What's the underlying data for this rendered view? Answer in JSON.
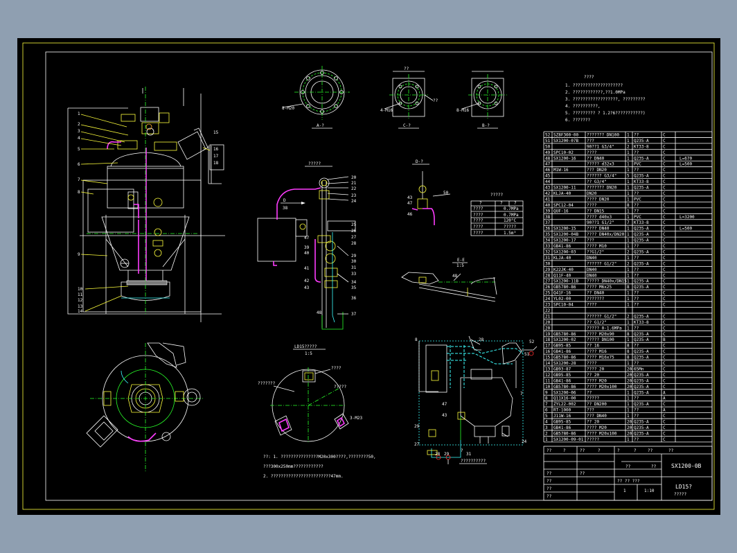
{
  "notes": {
    "title": "????",
    "items": [
      "1. ????????????????????",
      "2. ????????????,??1.0MPa",
      "3. ??????????????????,  ?????????",
      "4. ??????????,",
      "5. ?????????  ?  1.2?6???????????)",
      "6. ???????"
    ]
  },
  "pressure_table": {
    "title": "?????",
    "header": [
      "?",
      "?",
      "?"
    ],
    "rows": [
      [
        "????",
        "0.7MPa"
      ],
      [
        "????",
        "0.7MPa"
      ],
      [
        "????",
        "120°C"
      ],
      [
        "????",
        "?????"
      ],
      [
        "????",
        "1.5m³"
      ]
    ]
  },
  "section_labels": {
    "a": "A-?",
    "c": "C-?",
    "b": "B-?",
    "d": "D-?",
    "e": "E-E",
    "e_scale": "1:5",
    "ld": "LD15?????",
    "ld_scale": "1:5",
    "pipe_top": "?????",
    "bolts1": "8-M20",
    "bolts2": "4-M16",
    "bolts3": "8-M16",
    "bolts4": "3-M23",
    "system": "??????????",
    "ld_label1": "????",
    "ld_label2": "???????",
    "ld_label3": "?????"
  },
  "bottom_notes": [
    "??:  1. ???????????????M20x300????,????????50,",
    "       ???300x250mm????????????",
    "       2. ????????????????????????47mm."
  ],
  "parts": [
    [
      "52",
      "SZ8F300-00",
      "??????? DN100",
      "1",
      "??",
      "C"
    ],
    [
      "51",
      "SX1200-07B",
      "???",
      "1",
      "Q235-A",
      "C"
    ],
    [
      "50",
      "",
      "90??1  G3/4\"",
      "2",
      "KT33-8",
      "C"
    ],
    [
      "49",
      "SPC10-02",
      "????",
      "1",
      "??",
      "C"
    ],
    [
      "48",
      "SX1200-16",
      "??  DN40",
      "1",
      "Q235-A",
      "C"
    ],
    [
      "47",
      "",
      "?????  d32x3",
      "1",
      "PVC",
      "C"
    ],
    [
      "46",
      "M1W-16",
      "???  DN20",
      "1",
      "??",
      "C"
    ],
    [
      "45",
      "",
      "??????  G3/4\"",
      "5",
      "Q235-A",
      "C"
    ],
    [
      "44",
      "",
      "??  G3/4\"",
      "1",
      "KT33-8",
      "C"
    ],
    [
      "43",
      "SX1200-11",
      "???????  DN20",
      "1",
      "Q235-A",
      "C"
    ],
    [
      "42",
      "KLJA-40",
      "DN20",
      "1",
      "??",
      "C"
    ],
    [
      "41",
      "",
      "????  DN20",
      "1",
      "PVC",
      "C"
    ],
    [
      "40",
      "SPC12-04",
      "????",
      "8",
      "??",
      "C"
    ],
    [
      "39",
      "QUF-16",
      "??  DN15",
      "1",
      "??",
      "C"
    ],
    [
      "38",
      "",
      "????  d40x3",
      "1",
      "PVC",
      "C"
    ],
    [
      "37",
      "",
      "90??1  G1/2\"",
      "7",
      "KT33-8",
      "C"
    ],
    [
      "36",
      "SX1200-15",
      "????  DN40",
      "1",
      "Q235-A",
      "C"
    ],
    [
      "35",
      "SX1200-04B",
      "????  DN40x/DN20",
      "1",
      "Q235-A",
      "C"
    ],
    [
      "34",
      "SX1200-17",
      "???",
      "1",
      "Q235-A",
      "C"
    ],
    [
      "33",
      "GB41-86",
      "????  M10",
      "1",
      "??",
      "C"
    ],
    [
      "32",
      "SX1200-03",
      "??G1/2\"",
      "2",
      "Q235-A",
      "C"
    ],
    [
      "31",
      "KLJA-40",
      "DN40",
      "1",
      "??",
      "C"
    ],
    [
      "30",
      "",
      "??????  G1/2\"",
      "2",
      "Q235-A",
      "C"
    ],
    [
      "29",
      "K22JK-40",
      "DN40",
      "1",
      "??",
      "C"
    ],
    [
      "28",
      "Q11F-40",
      "DN40",
      "1",
      "??",
      "C"
    ],
    [
      "27",
      "SX1200-11B",
      "?????  DN40x/DN15",
      "1",
      "Q235-A",
      "C"
    ],
    [
      "26",
      "GB5780-86",
      "???? M6x25",
      "8",
      "Q235-A",
      "C"
    ],
    [
      "25",
      "Q41F-16",
      "??  DN40",
      "1",
      "??",
      "C"
    ],
    [
      "24",
      "YL02-00",
      "???????",
      "1",
      "??",
      "C"
    ],
    [
      "23",
      "SPC10-04",
      "????",
      "1",
      "??",
      "C"
    ],
    [
      "22",
      "",
      "",
      "",
      "",
      ""
    ],
    [
      "21",
      "",
      "??????  G1/2\"",
      "2",
      "Q235-A",
      "C"
    ],
    [
      "20",
      "",
      "??  G1/2\"",
      "1",
      "KT33-8",
      "C"
    ],
    [
      "20",
      "",
      "?????  0-1.6MPa",
      "1",
      "??",
      "C"
    ],
    [
      "19",
      "GB5780-86",
      "????  M20x90",
      "8",
      "Q235-A",
      "C"
    ],
    [
      "18",
      "SX1200-02",
      "?????  DN100",
      "1",
      "Q235-A",
      "B"
    ],
    [
      "17",
      "GB95-85",
      "??  16",
      "8",
      "??",
      "C"
    ],
    [
      "16",
      "GB41-86",
      "????  M16",
      "8",
      "Q235-A",
      "C"
    ],
    [
      "15",
      "GB5780-86",
      "????  M16x75",
      "8",
      "Q235-A",
      "C"
    ],
    [
      "14",
      "SX1200-28",
      "????",
      "1",
      "??",
      "C"
    ],
    [
      "13",
      "GB93-87",
      "????  20",
      "20",
      "65Mn",
      "C"
    ],
    [
      "12",
      "GB95-85",
      "??  20",
      "20",
      "Q235-A",
      "C"
    ],
    [
      "11",
      "GB41-86",
      "????  M20",
      "20",
      "Q235-A",
      "C"
    ],
    [
      "10",
      "GB5780-86",
      "????  M20x100",
      "20",
      "Q235-A",
      "C"
    ],
    [
      "9",
      "SX1200-06",
      "??",
      "1",
      "Q235-A",
      "A"
    ],
    [
      "8",
      "Q11X16-00",
      "?????",
      "1",
      "??",
      "A"
    ],
    [
      "7",
      "ZYL22-002",
      "??  DN200",
      "1",
      "Q235-A",
      "C"
    ],
    [
      "6",
      "RT-1000",
      "???",
      "1",
      "??",
      "A"
    ],
    [
      "5",
      "J11W-16",
      "???  DN40",
      "1",
      "??",
      "C"
    ],
    [
      "4",
      "GB95-85",
      "??  20",
      "20",
      "Q235-A",
      "C"
    ],
    [
      "3",
      "GB41-86",
      "????  M20",
      "20",
      "Q235-A",
      "C"
    ],
    [
      "2",
      "GB5780-86",
      "????  M20x100",
      "20",
      "Q235-A",
      "C"
    ],
    [
      "1",
      "SX1200-09-01",
      "?????",
      "1",
      "??",
      "C"
    ]
  ],
  "remarks": [
    {
      "row": 4,
      "text": "L=670"
    },
    {
      "row": 5,
      "text": "L=500"
    },
    {
      "row": 14,
      "text": "L=3200"
    },
    {
      "row": 16,
      "text": "L=500"
    }
  ],
  "title_block": {
    "header": [
      "??",
      "?",
      "??",
      "?",
      "?",
      "?",
      "??",
      "??"
    ],
    "drawing_no": "SX1200-0B",
    "product": "LD15?",
    "product_sub": "?????",
    "scale": "1:10",
    "sheet": "1",
    "weight": "??",
    "rows_left": [
      "??",
      "??",
      "??",
      "??",
      "??"
    ],
    "marks": [
      "??",
      "?? ??  ???",
      "??"
    ]
  },
  "callouts_main": [
    "1",
    "2",
    "3",
    "4",
    "5",
    "6",
    "7",
    "8",
    "9",
    "10",
    "11",
    "12",
    "13",
    "14",
    "15",
    "16",
    "17",
    "18",
    "19",
    "20",
    "21",
    "22",
    "23",
    "24",
    "25",
    "26",
    "27",
    "28",
    "29",
    "30",
    "31",
    "32",
    "33",
    "34",
    "35",
    "36",
    "37",
    "38",
    "39",
    "40",
    "41",
    "42",
    "43",
    "44",
    "45",
    "46",
    "47",
    "48",
    "49",
    "50",
    "51",
    "52"
  ],
  "colors": {
    "background": "#000000",
    "frame": "#ffff3c",
    "line": "#ffffff",
    "centerline": "#29ff29",
    "pipe": "#ff3cff",
    "aux": "#3cffff",
    "desktop": "#8f9fb1"
  }
}
